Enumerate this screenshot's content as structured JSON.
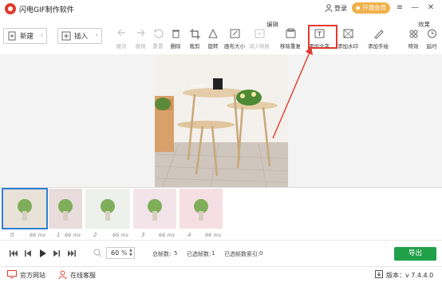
{
  "app": {
    "title": "闪电GIF制作软件"
  },
  "titlebar": {
    "login": "登录",
    "vip": "开通会员",
    "menu_icon": "menu-icon",
    "minimize_icon": "minimize-icon",
    "close_icon": "close-icon"
  },
  "toolbar": {
    "new_label": "新建",
    "insert_label": "插入",
    "section_edit": "编辑",
    "section_effect": "效果",
    "tools": [
      {
        "label": "撤消",
        "icon": "undo-icon",
        "enabled": false
      },
      {
        "label": "撤销",
        "icon": "redo-icon",
        "enabled": false
      },
      {
        "label": "重置",
        "icon": "reset-icon",
        "enabled": false
      },
      {
        "label": "删除",
        "icon": "delete-icon",
        "enabled": true
      },
      {
        "label": "裁剪",
        "icon": "crop-icon",
        "enabled": true
      },
      {
        "label": "旋转",
        "icon": "rotate-icon",
        "enabled": true
      },
      {
        "label": "画布大小",
        "icon": "canvas-size-icon",
        "enabled": true
      },
      {
        "label": "减少帧数",
        "icon": "reduce-frames-icon",
        "enabled": false
      },
      {
        "label": "移除重复",
        "icon": "remove-duplicates-icon",
        "enabled": true
      },
      {
        "label": "添加文字",
        "icon": "add-text-icon",
        "enabled": true
      },
      {
        "label": "添加水印",
        "icon": "add-watermark-icon",
        "enabled": true
      },
      {
        "label": "添加手绘",
        "icon": "add-drawing-icon",
        "enabled": true
      },
      {
        "label": "特效",
        "icon": "effects-icon",
        "enabled": true
      },
      {
        "label": "延时",
        "icon": "delay-icon",
        "enabled": true
      }
    ]
  },
  "frames": [
    {
      "index": "0",
      "duration": "66 ms",
      "selected": true
    },
    {
      "index": "1",
      "duration": "66 ms",
      "selected": false
    },
    {
      "index": "2",
      "duration": "66 ms",
      "selected": false
    },
    {
      "index": "3",
      "duration": "66 ms",
      "selected": false
    },
    {
      "index": "4",
      "duration": "66 ms",
      "selected": false
    }
  ],
  "playback": {
    "zoom_value": "60",
    "zoom_unit": "%",
    "total_frames_label": "总帧数:",
    "total_frames": "5",
    "selected_frames_label": "已选帧数:",
    "selected_frames": "1",
    "selected_index_label": "已选帧数索引:",
    "selected_index": "0",
    "export_label": "导出"
  },
  "statusbar": {
    "website": "官方网站",
    "support": "在线客服",
    "version": "版本：v 7.4.4.0"
  },
  "colors": {
    "brand_red": "#e03a2f",
    "vip_gold": "#f0b14a",
    "export_green": "#21a04a",
    "selection_blue": "#2d7fd3"
  }
}
